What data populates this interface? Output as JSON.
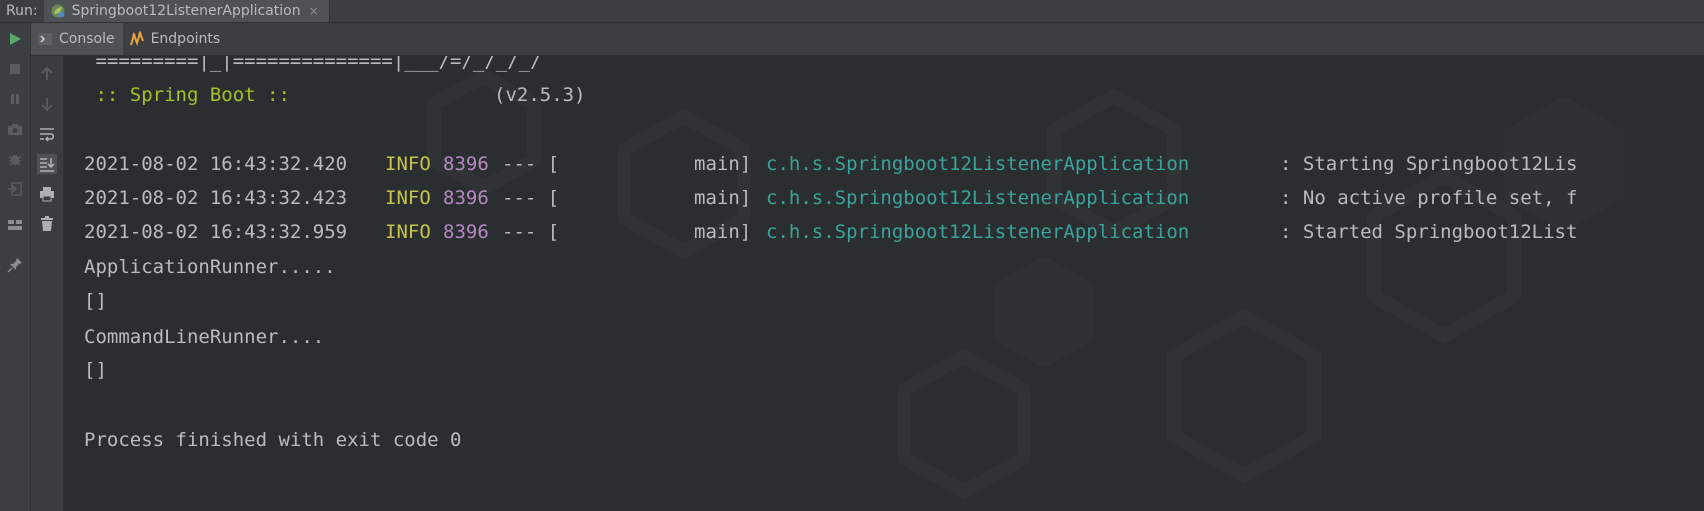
{
  "runbar": {
    "label": "Run:",
    "tab_title": "Springboot12ListenerApplication",
    "close_glyph": "×"
  },
  "tabs": [
    {
      "label": "Console",
      "icon": "console-icon"
    },
    {
      "label": "Endpoints",
      "icon": "endpoints-icon"
    }
  ],
  "left_actions": [
    "run-icon",
    "stop-icon",
    "pause-icon",
    "camera-icon",
    "debug-bug-icon",
    "exit-icon",
    "layout-icon",
    "pin-icon"
  ],
  "tool_actions": [
    "up-arrow-icon",
    "down-arrow-icon",
    "soft-wrap-icon",
    "scroll-to-end-icon",
    "print-icon",
    "trash-icon"
  ],
  "console": {
    "banner_partial": " =========|_|==============|___/=/_/_/_/",
    "spring_boot": " :: Spring Boot :: ",
    "version": "(v2.5.3)",
    "logs": [
      {
        "ts": "2021-08-02 16:43:32.420",
        "level": "INFO",
        "pid": "8396",
        "sep": "--- [",
        "thread": "main]",
        "logger": "c.h.s.Springboot12ListenerApplication",
        "msg": ": Starting Springboot12Lis"
      },
      {
        "ts": "2021-08-02 16:43:32.423",
        "level": "INFO",
        "pid": "8396",
        "sep": "--- [",
        "thread": "main]",
        "logger": "c.h.s.Springboot12ListenerApplication",
        "msg": ": No active profile set, f"
      },
      {
        "ts": "2021-08-02 16:43:32.959",
        "level": "INFO",
        "pid": "8396",
        "sep": "--- [",
        "thread": "main]",
        "logger": "c.h.s.Springboot12ListenerApplication",
        "msg": ": Started Springboot12List"
      }
    ],
    "app_runner": "ApplicationRunner.....",
    "brackets1": "[]",
    "cmd_runner": "CommandLineRunner....",
    "brackets2": "[]",
    "process_finished": "Process finished with exit code 0"
  },
  "colors": {
    "spring_green": "#a8c023",
    "info_yellow": "#c5c54a",
    "pid_purple": "#b589c2",
    "logger_teal": "#3aa39a"
  }
}
